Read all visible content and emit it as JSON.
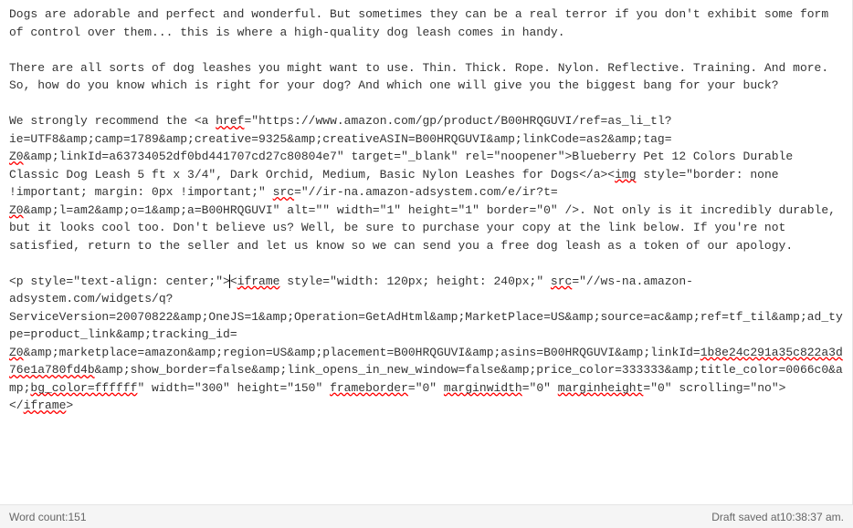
{
  "editor": {
    "para1": "Dogs are adorable and perfect and wonderful. But sometimes they can be a real terror if you don't exhibit some form of control over them... this is where a high-quality dog leash comes in handy.",
    "para2": "There are all sorts of dog leashes you might want to use. Thin. Thick. Rope. Nylon. Reflective. Training. And more. So, how do you know which is right for your dog? And which one will give you the biggest bang for your buck?",
    "para3_a": "We strongly recommend the <a ",
    "para3_href": "href",
    "para3_b": "=\"https://www.amazon.com/gp/product/B00HRQGUVI/ref=as_li_tl?ie=UTF8&amp;camp=1789&amp;creative=9325&amp;creativeASIN=B00HRQGUVI&amp;linkCode=as2&amp;tag=",
    "para3_z0a": "Z0",
    "para3_c": "&amp;linkId=a63734052df0bd441707cd27c80804e7\" target=\"_blank\" rel=\"noopener\">Blueberry Pet 12 Colors Durable Classic Dog Leash 5 ft x 3/4\", Dark Orchid, Medium, Basic Nylon Leashes for Dogs</a><",
    "para3_img": "img",
    "para3_d": " style=\"border: none !important; margin: 0px !important;\" ",
    "para3_src": "src",
    "para3_e": "=\"//ir-na.amazon-adsystem.com/e/ir?t=",
    "para3_z0b": "Z0",
    "para3_f": "&amp;l=am2&amp;o=1&amp;a=B00HRQGUVI\" alt=\"\" width=\"1\" height=\"1\" border=\"0\" />. Not only is it incredibly durable, but it looks cool too. Don't believe us? Well, be sure to purchase your copy at the link below. If you're not satisfied, return to the seller and let us know so we can send you a free dog leash as a token of our apology.",
    "para4_a": "<p style=\"text-align: center;\">",
    "para4_b": "<",
    "para4_iframe": "iframe",
    "para4_c": " style=\"width: 120px; height: 240px;\" ",
    "para4_src": "src",
    "para4_d": "=\"//ws-na.amazon-adsystem.com/widgets/q?ServiceVersion=20070822&amp;OneJS=1&amp;Operation=GetAdHtml&amp;MarketPlace=US&amp;source=ac&amp;ref=tf_til&amp;ad_type=product_link&amp;tracking_id=",
    "para4_z0": "Z0",
    "para4_e": "&amp;marketplace=amazon&amp;region=US&amp;placement=B00HRQGUVI&amp;asins=B00HRQGUVI&amp;linkId=",
    "para4_linkid": "1b8e24c291a35c822a3d76e1a780fd4b",
    "para4_f": "&amp;show_border=false&amp;link_opens_in_new_window=false&amp;price_color=333333&amp;title_color=0066c0&amp;",
    "para4_bgcolor": "bg_color=ffffff",
    "para4_g": "\" width=\"300\" height=\"150\" ",
    "para4_frameborder": "frameborder",
    "para4_h": "=\"0\" ",
    "para4_marginwidth": "marginwidth",
    "para4_i": "=\"0\" ",
    "para4_marginheight": "marginheight",
    "para4_j": "=\"0\" scrolling=\"no\"></",
    "para4_iframe2": "iframe",
    "para4_k": ">"
  },
  "status": {
    "word_count_label": "Word count: ",
    "word_count_value": "151",
    "draft_saved_label": "Draft saved at ",
    "draft_saved_time": "10:38:37 am."
  }
}
